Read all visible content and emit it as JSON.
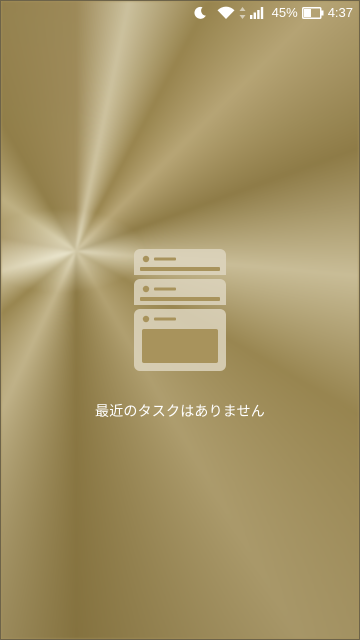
{
  "status_bar": {
    "icons": [
      "moon-icon",
      "wifi-icon",
      "data-arrows-icon",
      "cellular-signal-icon",
      "battery-icon"
    ],
    "battery_percent": "45%",
    "battery_level": 0.45,
    "time": "4:37"
  },
  "recents": {
    "empty_message": "最近のタスクはありません",
    "illustration": "stacked-cards-icon"
  },
  "colors": {
    "status_text": "#ffffff",
    "illustration": "#ddd5be",
    "message_text": "#ffffff"
  }
}
